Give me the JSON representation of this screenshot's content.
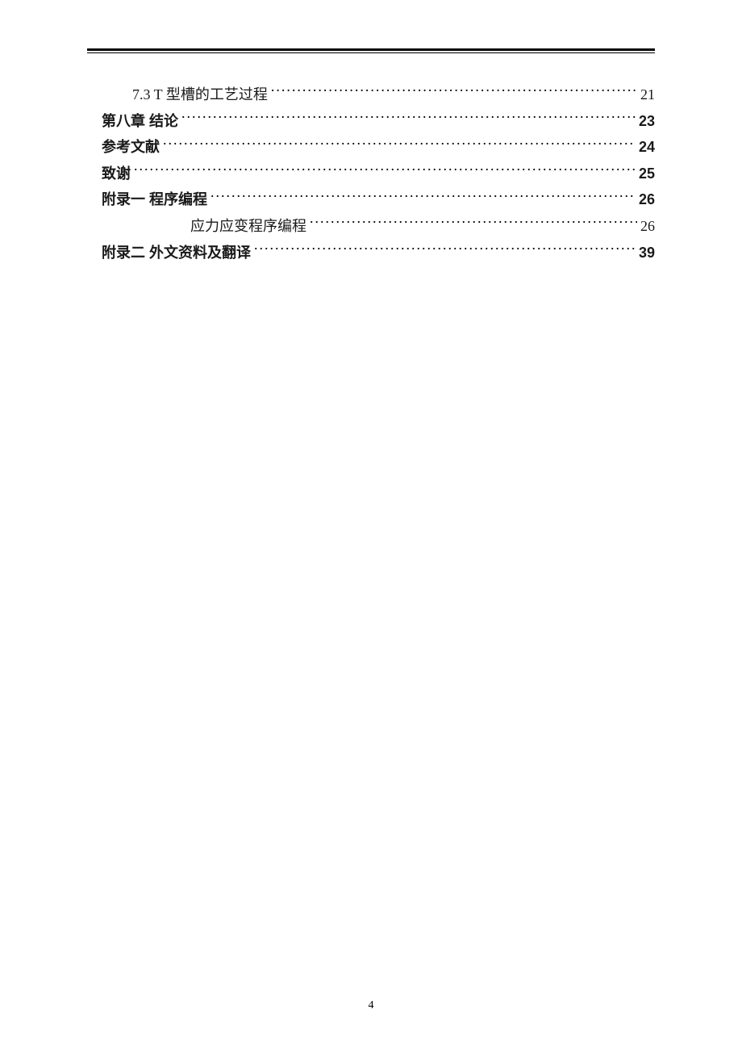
{
  "toc": {
    "entries": [
      {
        "title": "7.3 T 型槽的工艺过程",
        "page": "21",
        "indent": 1,
        "bold": false
      },
      {
        "title": "第八章  结论",
        "page": "23",
        "indent": 0,
        "bold": true
      },
      {
        "title": "参考文献",
        "page": "24",
        "indent": 0,
        "bold": true
      },
      {
        "title": "致谢",
        "page": "25",
        "indent": 0,
        "bold": true
      },
      {
        "title": "附录一    程序编程",
        "page": "26",
        "indent": 0,
        "bold": true
      },
      {
        "title": "应力应变程序编程",
        "page": "26",
        "indent": 2,
        "bold": false
      },
      {
        "title": "附录二    外文资料及翻译",
        "page": "39",
        "indent": 0,
        "bold": true
      }
    ]
  },
  "pageNumber": "4"
}
